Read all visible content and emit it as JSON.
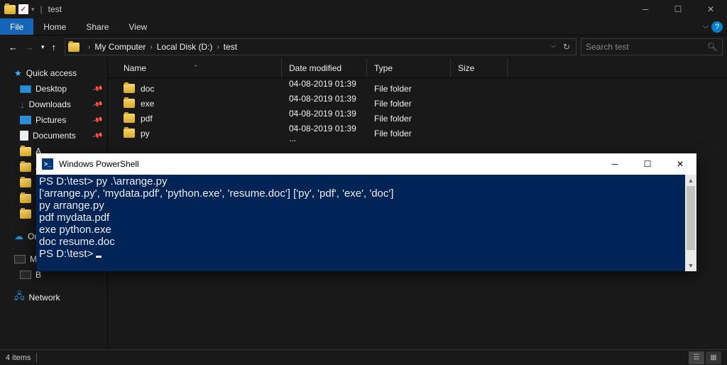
{
  "window": {
    "title": "test"
  },
  "ribbon": {
    "file": "File",
    "home": "Home",
    "share": "Share",
    "view": "View"
  },
  "breadcrumb": {
    "root": "My Computer",
    "disk": "Local Disk (D:)",
    "folder": "test"
  },
  "search": {
    "placeholder": "Search test"
  },
  "sidebar": {
    "quick": "Quick access",
    "desktop": "Desktop",
    "downloads": "Downloads",
    "pictures": "Pictures",
    "documents": "Documents",
    "onedrive": "On",
    "thispc1": "My",
    "thispc2": "B",
    "network": "Network"
  },
  "columns": {
    "name": "Name",
    "date": "Date modified",
    "type": "Type",
    "size": "Size"
  },
  "rows": [
    {
      "name": "doc",
      "date": "04-08-2019 01:39 ...",
      "type": "File folder"
    },
    {
      "name": "exe",
      "date": "04-08-2019 01:39 ...",
      "type": "File folder"
    },
    {
      "name": "pdf",
      "date": "04-08-2019 01:39 ...",
      "type": "File folder"
    },
    {
      "name": "py",
      "date": "04-08-2019 01:39 ...",
      "type": "File folder"
    }
  ],
  "status": {
    "items": "4 items"
  },
  "powershell": {
    "title": "Windows PowerShell",
    "lines": "PS D:\\test> py .\\arrange.py\n['arrange.py', 'mydata.pdf', 'python.exe', 'resume.doc'] ['py', 'pdf', 'exe', 'doc']\npy arrange.py\npdf mydata.pdf\nexe python.exe\ndoc resume.doc\nPS D:\\test> "
  }
}
